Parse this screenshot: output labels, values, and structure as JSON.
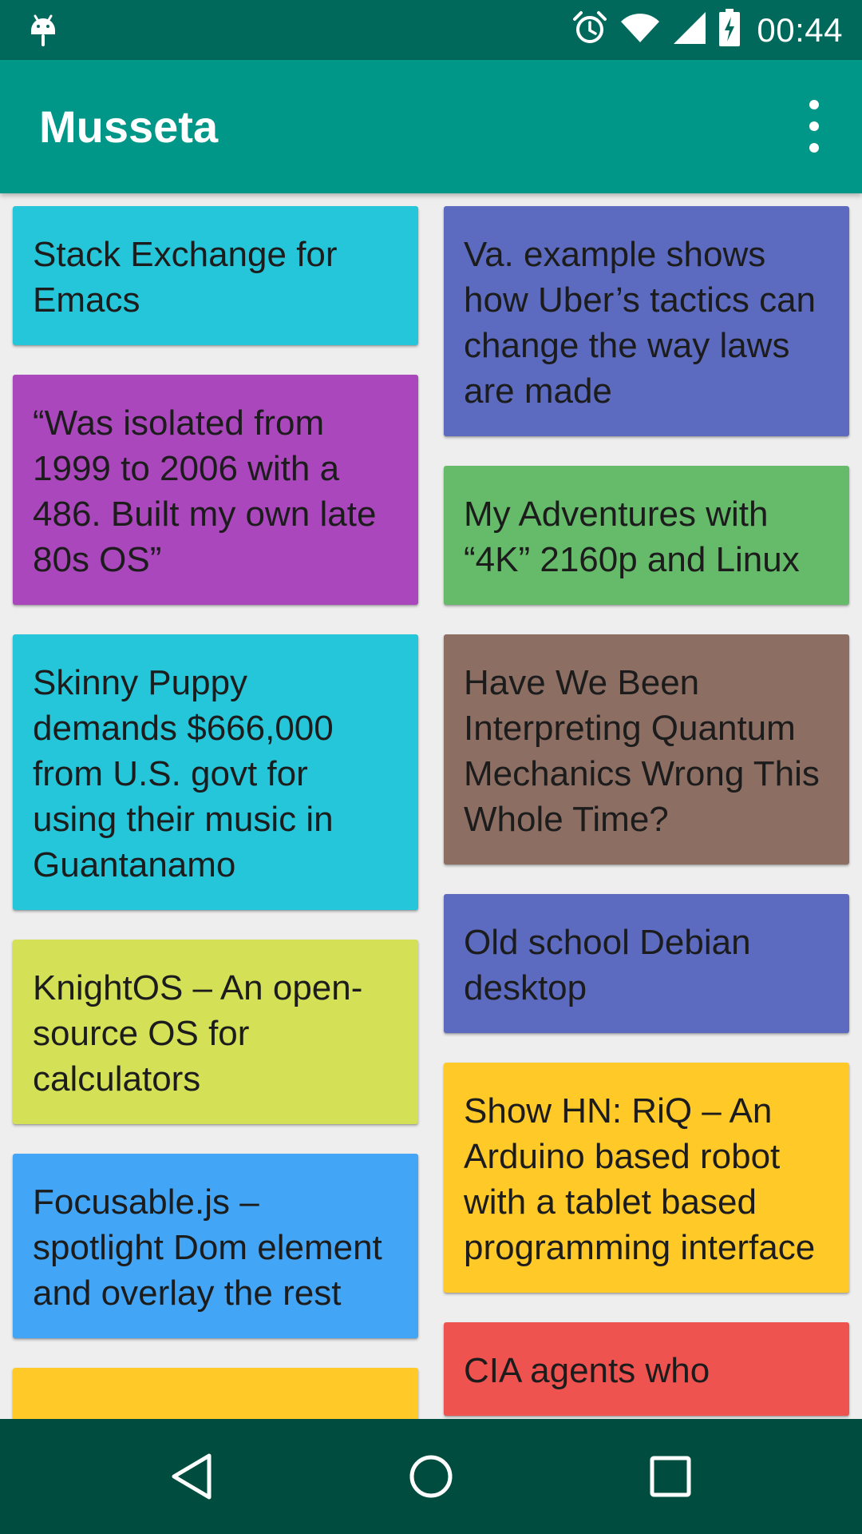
{
  "status_bar": {
    "time": "00:44",
    "icons": [
      "android-debug-icon",
      "alarm-icon",
      "wifi-icon",
      "cell-signal-icon",
      "battery-charging-icon"
    ]
  },
  "app_bar": {
    "title": "Musseta",
    "menu_icon": "overflow-menu-icon"
  },
  "colors": {
    "status_bar": "#00695c",
    "app_bar": "#009688",
    "nav_bar": "#004d40",
    "background": "#eeeeee"
  },
  "cards_left": [
    {
      "text": "Stack Exchange for Emacs",
      "color": "#26c6da"
    },
    {
      "text": "“Was isolated from 1999 to 2006 with a 486. Built my own late 80s OS”",
      "color": "#ab47bc"
    },
    {
      "text": "Skinny Puppy demands $666,000 from U.S. govt for using their music in Guantanamo",
      "color": "#26c6da"
    },
    {
      "text": "KnightOS – An open-source OS for calculators",
      "color": "#d4e157"
    },
    {
      "text": "Focusable.js – spotlight Dom element and overlay the rest",
      "color": "#42a5f5"
    },
    {
      "text": "",
      "color": "#ffca28"
    }
  ],
  "cards_right": [
    {
      "text": "Va. example shows how Uber’s tactics can change the way laws are made",
      "color": "#5c6bc0"
    },
    {
      "text": "My Adventures with “4K” 2160p and Linux",
      "color": "#66bb6a"
    },
    {
      "text": "Have We Been Interpreting Quantum Mechanics Wrong This Whole Time?",
      "color": "#8d6e63"
    },
    {
      "text": "Old school Debian desktop",
      "color": "#5c6bc0"
    },
    {
      "text": "Show HN: RiQ – An Arduino based robot with a tablet based programming interface",
      "color": "#ffca28"
    },
    {
      "text": "CIA agents who",
      "color": "#ef5350"
    }
  ],
  "nav_bar": {
    "back": "back-icon",
    "home": "home-icon",
    "recents": "recents-icon"
  }
}
